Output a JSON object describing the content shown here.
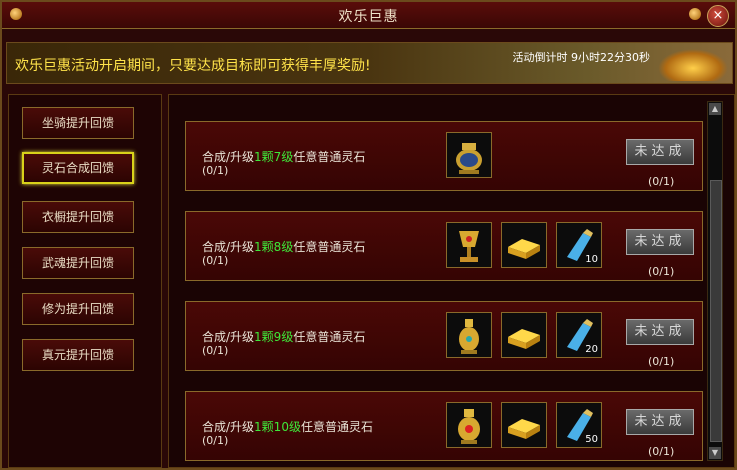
{
  "window": {
    "title": "欢乐巨惠",
    "close_label": "×"
  },
  "banner": {
    "text": "欢乐巨惠活动开启期间，只要达成目标即可获得丰厚奖励!",
    "countdown": "活动倒计时 9小时22分30秒"
  },
  "sidebar": {
    "items": [
      {
        "label": "坐骑提升回馈",
        "active": false
      },
      {
        "label": "灵石合成回馈",
        "active": true
      },
      {
        "label": "衣橱提升回馈",
        "active": false
      },
      {
        "label": "武魂提升回馈",
        "active": false
      },
      {
        "label": "修为提升回馈",
        "active": false
      },
      {
        "label": "真元提升回馈",
        "active": false
      }
    ]
  },
  "goals": [
    {
      "prefix": "合成/升级",
      "highlight": "1颗7级",
      "suffix": "任意普通灵石",
      "progress_text": "(0/1)",
      "status_label": "未达成",
      "progress": "(0/1)",
      "rewards": [
        {
          "icon": "golden-urn-icon",
          "count": ""
        }
      ]
    },
    {
      "prefix": "合成/升级",
      "highlight": "1颗8级",
      "suffix": "任意普通灵石",
      "progress_text": "(0/1)",
      "status_label": "未达成",
      "progress": "(0/1)",
      "rewards": [
        {
          "icon": "golden-chalice-icon",
          "count": ""
        },
        {
          "icon": "gold-ingot-icon",
          "count": ""
        },
        {
          "icon": "blue-potion-icon",
          "count": "10"
        }
      ]
    },
    {
      "prefix": "合成/升级",
      "highlight": "1颗9级",
      "suffix": "任意普通灵石",
      "progress_text": "(0/1)",
      "status_label": "未达成",
      "progress": "(0/1)",
      "rewards": [
        {
          "icon": "golden-vase-icon",
          "count": ""
        },
        {
          "icon": "gold-ingot-icon",
          "count": ""
        },
        {
          "icon": "blue-potion-icon",
          "count": "20"
        }
      ]
    },
    {
      "prefix": "合成/升级",
      "highlight": "1颗10级",
      "suffix": "任意普通灵石",
      "progress_text": "(0/1)",
      "status_label": "未达成",
      "progress": "(0/1)",
      "rewards": [
        {
          "icon": "ruby-vase-icon",
          "count": ""
        },
        {
          "icon": "gold-ingot-icon",
          "count": ""
        },
        {
          "icon": "blue-potion-icon",
          "count": "50"
        }
      ]
    }
  ]
}
